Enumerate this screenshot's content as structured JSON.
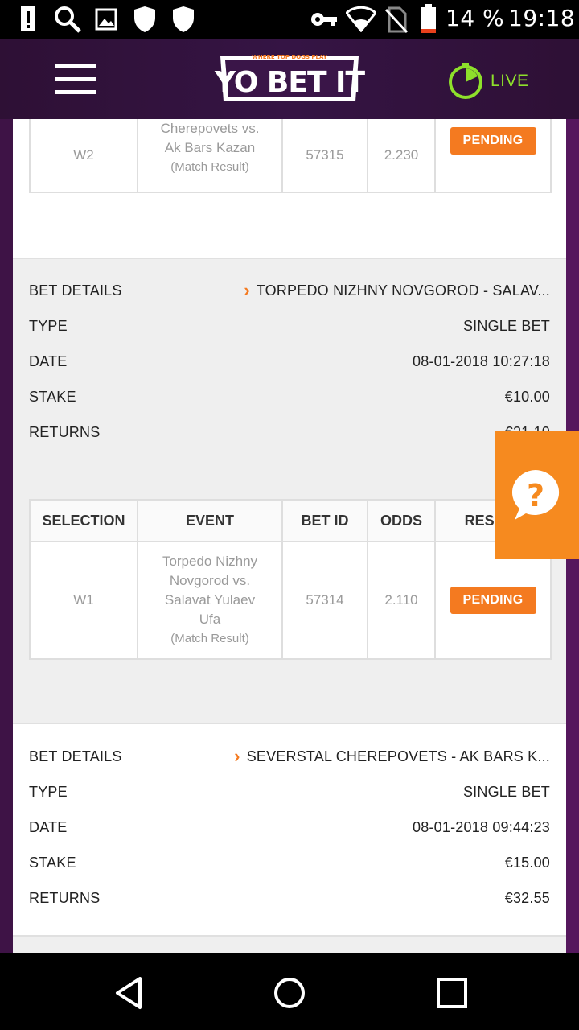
{
  "status_bar": {
    "battery_text": "14 %",
    "time": "19:18",
    "icons": [
      "alert-icon",
      "search-icon",
      "image-icon",
      "shield-icon",
      "shield-icon",
      "key-icon",
      "wifi-icon",
      "no-sim-icon",
      "battery-icon"
    ]
  },
  "header": {
    "logo_tagline": "WHERE TOP DOGS PLAY",
    "logo_text": "YO BET IT",
    "live_label": "LIVE",
    "live_color": "#8ee02b"
  },
  "top_partial": {
    "selection": "W2",
    "event_line1": "Cherepovets vs.",
    "event_line2": "Ak Bars Kazan",
    "event_sub": "(Match Result)",
    "bet_id": "57315",
    "odds": "2.230",
    "result": "PENDING"
  },
  "bet1": {
    "details_label": "BET DETAILS",
    "details_value": "TORPEDO NIZHNY NOVGOROD - SALAV...",
    "type_label": "TYPE",
    "type_value": "SINGLE BET",
    "date_label": "DATE",
    "date_value": "08-01-2018 10:27:18",
    "stake_label": "STAKE",
    "stake_value": "€10.00",
    "returns_label": "RETURNS",
    "returns_value": "€21.10",
    "table": {
      "headers": [
        "SELECTION",
        "EVENT",
        "BET ID",
        "ODDS",
        "RESULT"
      ],
      "selection": "W1",
      "event_lines": [
        "Torpedo Nizhny",
        "Novgorod vs.",
        "Salavat Yulaev",
        "Ufa"
      ],
      "event_sub": "(Match Result)",
      "bet_id": "57314",
      "odds": "2.110",
      "result": "PENDING"
    }
  },
  "bet2": {
    "details_label": "BET DETAILS",
    "details_value": "SEVERSTAL CHEREPOVETS - AK BARS K...",
    "type_label": "TYPE",
    "type_value": "SINGLE BET",
    "date_label": "DATE",
    "date_value": "08-01-2018 09:44:23",
    "stake_label": "STAKE",
    "stake_value": "€15.00",
    "returns_label": "RETURNS",
    "returns_value": "€32.55"
  },
  "colors": {
    "accent_orange": "#f47a20",
    "header_purple": "#2e1035",
    "help_orange": "#f68a1f"
  }
}
